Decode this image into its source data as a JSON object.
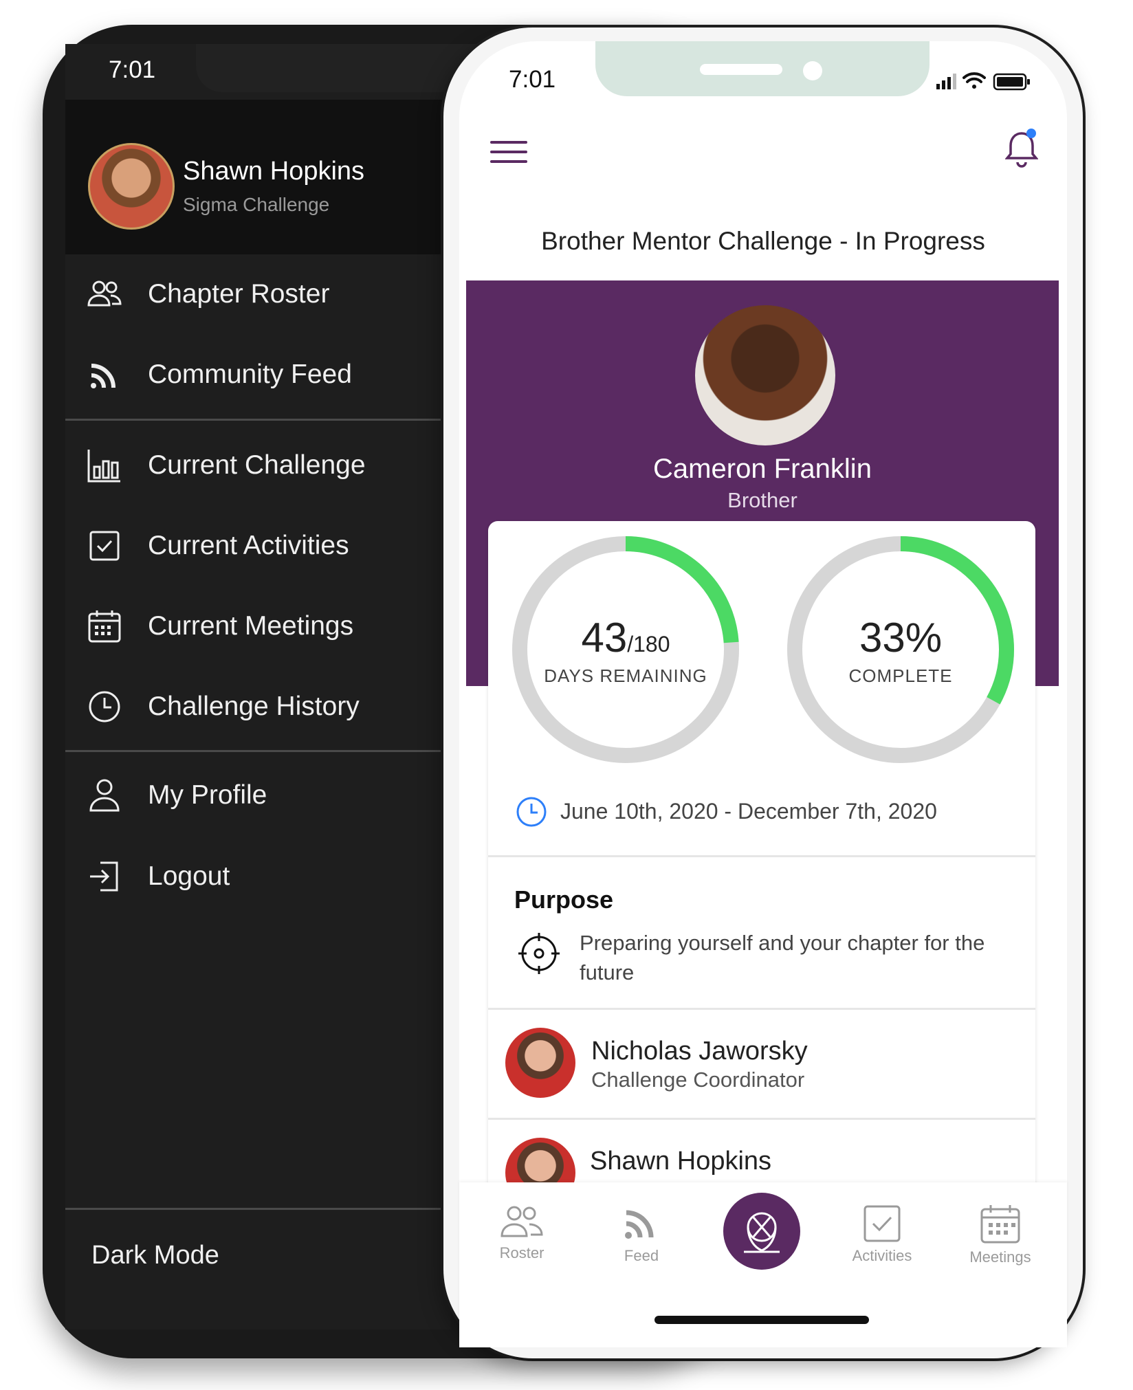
{
  "dark_phone": {
    "time": "7:01",
    "user_name": "Shawn Hopkins",
    "user_subtitle": "Sigma Challenge",
    "menu": [
      {
        "label": "Chapter Roster",
        "icon": "users-icon"
      },
      {
        "label": "Community Feed",
        "icon": "rss-icon"
      },
      {
        "label": "Current Challenge",
        "icon": "bar-chart-icon"
      },
      {
        "label": "Current Activities",
        "icon": "checkbox-icon"
      },
      {
        "label": "Current Meetings",
        "icon": "calendar-icon"
      },
      {
        "label": "Challenge History",
        "icon": "clock-icon"
      },
      {
        "label": "My Profile",
        "icon": "user-icon"
      },
      {
        "label": "Logout",
        "icon": "logout-icon"
      }
    ],
    "dark_mode_label": "Dark Mode"
  },
  "light_phone": {
    "time": "7:01",
    "page_title": "Brother Mentor Challenge - In Progress",
    "profile": {
      "name": "Cameron Franklin",
      "role": "Brother"
    },
    "days": {
      "value": "43",
      "total": "/180",
      "label": "DAYS REMAINING",
      "fraction": 0.239
    },
    "progress": {
      "value": "33%",
      "label": "COMPLETE",
      "fraction": 0.33
    },
    "date_range": "June 10th, 2020 - December 7th, 2020",
    "purpose": {
      "heading": "Purpose",
      "text": "Preparing yourself and your chapter for the future"
    },
    "people": [
      {
        "name": "Nicholas Jaworsky",
        "role": "Challenge Coordinator"
      },
      {
        "name": "Shawn Hopkins"
      }
    ],
    "tabs": [
      {
        "label": "Roster",
        "icon": "users-icon"
      },
      {
        "label": "Feed",
        "icon": "rss-icon"
      },
      {
        "label": "",
        "icon": "crest-icon"
      },
      {
        "label": "Activities",
        "icon": "checkbox-icon"
      },
      {
        "label": "Meetings",
        "icon": "calendar-icon"
      }
    ]
  },
  "colors": {
    "brand_purple": "#5a2a62",
    "progress_green": "#4cd964",
    "ring_track": "#d6d6d6",
    "dark_bg": "#1e1e1e",
    "notification_dot": "#2d7ff9"
  }
}
